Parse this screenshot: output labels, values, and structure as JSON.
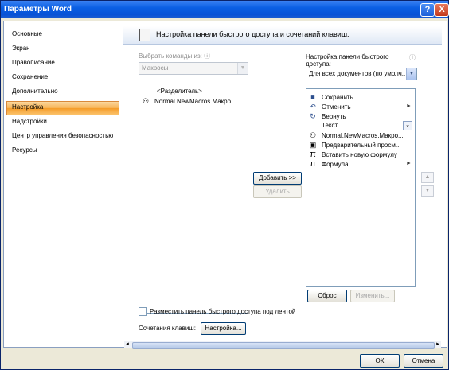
{
  "window": {
    "title": "Параметры Word",
    "help_glyph": "?",
    "close_glyph": "X"
  },
  "sidebar": {
    "items": [
      {
        "label": "Основные"
      },
      {
        "label": "Экран"
      },
      {
        "label": "Правописание"
      },
      {
        "label": "Сохранение"
      },
      {
        "label": "Дополнительно"
      },
      {
        "label": "Настройка",
        "selected": true
      },
      {
        "label": "Надстройки"
      },
      {
        "label": "Центр управления безопасностью"
      },
      {
        "label": "Ресурсы"
      }
    ]
  },
  "header": {
    "title": "Настройка панели быстрого доступа и сочетаний клавиш."
  },
  "left_panel": {
    "choose_label": "Выбрать команды из:",
    "info_glyph": "ⓘ",
    "choose_value": "Макросы",
    "items": [
      {
        "label": "<Разделитель>",
        "icon": ""
      },
      {
        "label": "Normal.NewMacros.Макро...",
        "icon": "macro-icon"
      }
    ]
  },
  "right_panel": {
    "setup_label_1": "Настройка панели быстрого",
    "setup_label_2": "доступа:",
    "info_glyph": "ⓘ",
    "doc_value": "Для всех документов (по умолч...",
    "items": [
      {
        "label": "Сохранить",
        "icon": "save-icon",
        "glyph": "■",
        "submenu": false
      },
      {
        "label": "Отменить",
        "icon": "undo-icon",
        "glyph": "↶",
        "submenu": true
      },
      {
        "label": "Вернуть",
        "icon": "redo-icon",
        "glyph": "↻",
        "submenu": false
      },
      {
        "label": "Текст",
        "icon": "",
        "glyph": "",
        "submenu": false
      },
      {
        "label": "Normal.NewMacros.Макро...",
        "icon": "macro-icon",
        "glyph": "⚇",
        "submenu": false
      },
      {
        "label": "Предварительный просм...",
        "icon": "preview-icon",
        "glyph": "▣",
        "submenu": false
      },
      {
        "label": "Вставить новую формулу",
        "icon": "pi-icon",
        "glyph": "π",
        "submenu": false
      },
      {
        "label": "Формула",
        "icon": "pi-icon",
        "glyph": "π",
        "submenu": true
      }
    ]
  },
  "buttons": {
    "add": "Добавить >>",
    "remove": "Удалить",
    "reset": "Сброс",
    "modify": "Изменить...",
    "customize": "Настройка...",
    "ok": "ОК",
    "cancel": "Отмена",
    "move_up": "▲",
    "move_down": "▼"
  },
  "options": {
    "below_ribbon": "Разместить панель быстрого доступа под лентой",
    "below_ribbon_checked": false,
    "shortcuts_label": "Сочетания клавиш:"
  },
  "scrollbar": {
    "left": "◄",
    "right": "►"
  },
  "colors": {
    "title_bar": "#0852d6",
    "selected_item": "#f7b253",
    "close_button": "#c2381b"
  }
}
